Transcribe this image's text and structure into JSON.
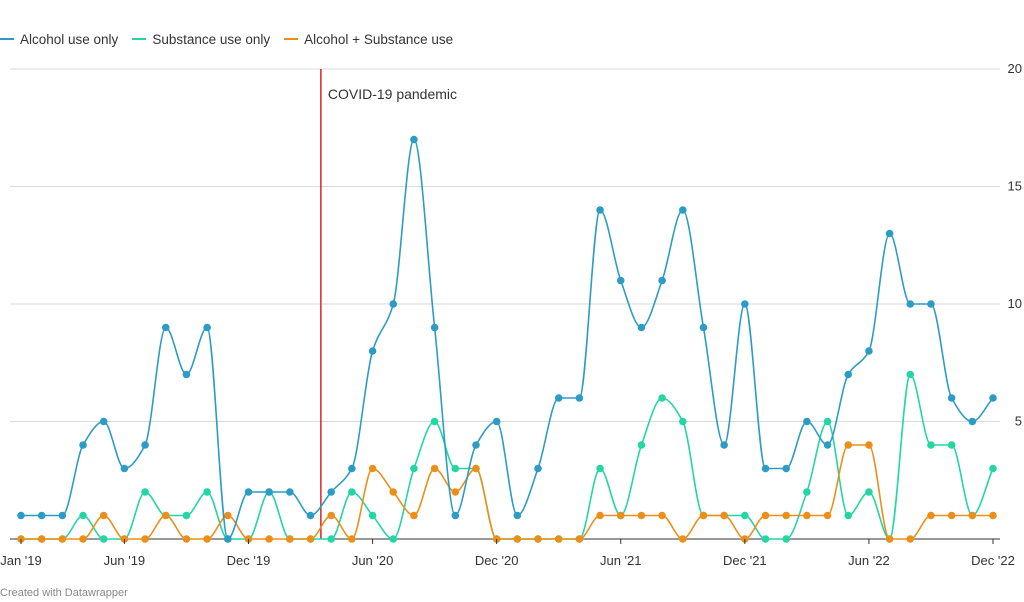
{
  "legend": [
    {
      "label": "Alcohol use only",
      "color": "#2d9cc5"
    },
    {
      "label": "Substance use only",
      "color": "#23d6a4"
    },
    {
      "label": "Alcohol + Substance use",
      "color": "#ec8f1a"
    }
  ],
  "credit": "Created with Datawrapper",
  "annotation": {
    "label": "COVID-19 pandemic",
    "x_index": 14.5,
    "color": "#d62728"
  },
  "chart_data": {
    "type": "line",
    "title": "",
    "xlabel": "",
    "ylabel": "",
    "ylim": [
      0,
      20
    ],
    "yticks": [
      5,
      10,
      15,
      20
    ],
    "grid": true,
    "legend_position": "top-left",
    "x": [
      "Jan '19",
      "Feb '19",
      "Mar '19",
      "Apr '19",
      "May '19",
      "Jun '19",
      "Jul '19",
      "Aug '19",
      "Sep '19",
      "Oct '19",
      "Nov '19",
      "Dec '19",
      "Jan '20",
      "Feb '20",
      "Mar '20",
      "Apr '20",
      "May '20",
      "Jun '20",
      "Jul '20",
      "Aug '20",
      "Sep '20",
      "Oct '20",
      "Nov '20",
      "Dec '20",
      "Jan '21",
      "Feb '21",
      "Mar '21",
      "Apr '21",
      "May '21",
      "Jun '21",
      "Jul '21",
      "Aug '21",
      "Sep '21",
      "Oct '21",
      "Nov '21",
      "Dec '21",
      "Jan '22",
      "Feb '22",
      "Mar '22",
      "Apr '22",
      "May '22",
      "Jun '22",
      "Jul '22",
      "Aug '22",
      "Sep '22",
      "Oct '22",
      "Nov '22",
      "Dec '22"
    ],
    "xticks": [
      {
        "index": 0,
        "label": "Jan '19"
      },
      {
        "index": 5,
        "label": "Jun '19"
      },
      {
        "index": 11,
        "label": "Dec '19"
      },
      {
        "index": 17,
        "label": "Jun '20"
      },
      {
        "index": 23,
        "label": "Dec '20"
      },
      {
        "index": 29,
        "label": "Jun '21"
      },
      {
        "index": 35,
        "label": "Dec '21"
      },
      {
        "index": 41,
        "label": "Jun '22"
      },
      {
        "index": 47,
        "label": "Dec '22"
      }
    ],
    "series": [
      {
        "name": "Alcohol use only",
        "color": "#2d9cc5",
        "values": [
          1,
          1,
          1,
          4,
          5,
          3,
          4,
          9,
          7,
          9,
          0,
          2,
          2,
          2,
          1,
          2,
          3,
          8,
          10,
          17,
          9,
          1,
          4,
          5,
          1,
          3,
          6,
          6,
          14,
          11,
          9,
          11,
          14,
          9,
          4,
          10,
          3,
          3,
          5,
          4,
          7,
          8,
          13,
          10,
          10,
          6,
          5,
          6
        ]
      },
      {
        "name": "Substance use only",
        "color": "#23d6a4",
        "values": [
          0,
          0,
          0,
          1,
          0,
          0,
          2,
          1,
          1,
          2,
          0,
          0,
          2,
          0,
          0,
          0,
          2,
          1,
          0,
          3,
          5,
          3,
          3,
          0,
          0,
          0,
          0,
          0,
          3,
          1,
          4,
          6,
          5,
          1,
          1,
          1,
          0,
          0,
          2,
          5,
          1,
          2,
          0,
          7,
          4,
          4,
          1,
          3
        ]
      },
      {
        "name": "Alcohol + Substance use",
        "color": "#ec8f1a",
        "values": [
          0,
          0,
          0,
          0,
          1,
          0,
          0,
          1,
          0,
          0,
          1,
          0,
          0,
          0,
          0,
          1,
          0,
          3,
          2,
          1,
          3,
          2,
          3,
          0,
          0,
          0,
          0,
          0,
          1,
          1,
          1,
          1,
          0,
          1,
          1,
          0,
          1,
          1,
          1,
          1,
          4,
          4,
          0,
          0,
          1,
          1,
          1,
          1
        ]
      }
    ]
  }
}
